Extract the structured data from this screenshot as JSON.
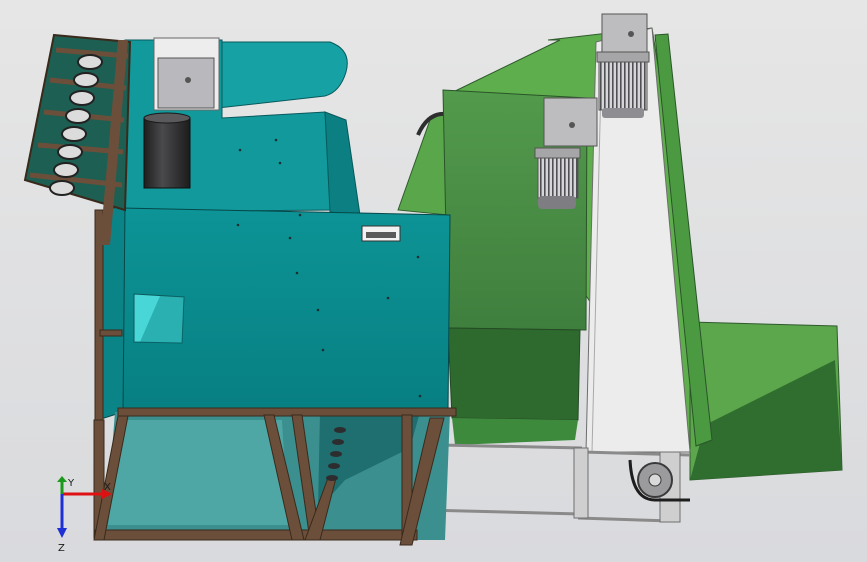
{
  "viewport": {
    "background": "#e1e1e3"
  },
  "colors": {
    "teal_front": "#0a8c8e",
    "teal_light": "#17a7aa",
    "teal_dark": "#06666a",
    "green_front": "#4d8f4a",
    "green_light": "#5fae4d",
    "green_dark": "#2f6a2e",
    "wood": "#6b4f3a",
    "belt": "#ececec",
    "motor": "#b9b9bf",
    "motor_dark": "#4d4d4f"
  },
  "triad": {
    "x_label": "X",
    "y_label": "Y",
    "z_label": "Z"
  }
}
